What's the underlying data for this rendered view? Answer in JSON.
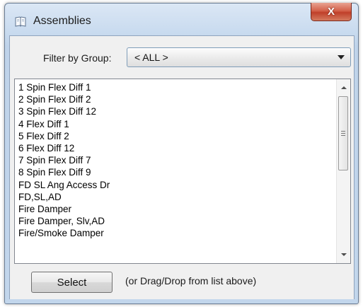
{
  "window": {
    "title": "Assemblies",
    "close_glyph": "X"
  },
  "icons": {
    "app": "book-icon",
    "close": "close-icon",
    "dropdown": "chevron-down-icon",
    "scroll_up": "arrow-up-icon",
    "scroll_down": "arrow-down-icon"
  },
  "filter": {
    "label": "Filter by Group:",
    "value": "< ALL >"
  },
  "list": {
    "items": [
      "1 Spin Flex Diff 1",
      "2 Spin Flex Diff 2",
      "3 Spin Flex Diff 12",
      "4 Flex Diff 1",
      "5 Flex Diff 2",
      "6 Flex Diff 12",
      "7 Spin Flex Diff 7",
      "8 Spin Flex Diff 9",
      "FD SL Ang Access Dr",
      "FD,SL,AD",
      "Fire Damper",
      "Fire Damper, Slv,AD",
      "Fire/Smoke Damper"
    ]
  },
  "footer": {
    "select_label": "Select",
    "hint": "(or Drag/Drop from list above)"
  },
  "colors": {
    "close_accent": "#c7462f",
    "frame": "#c2d6ec",
    "client_bg": "#f0f0f0"
  }
}
